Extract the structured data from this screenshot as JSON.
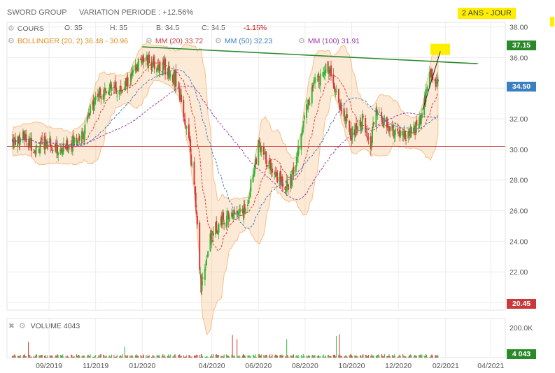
{
  "header": {
    "title": "SWORD GROUP",
    "variation": "VARIATION PERIODE : +12.56%",
    "period_badge": "2 ANS - JOUR"
  },
  "legend": {
    "cours": {
      "label": "COURS",
      "open": "O: 35",
      "high": "H: 35",
      "bid": "B: 34.5",
      "close": "C: 34.5",
      "change": "-1.15%"
    },
    "bollinger": {
      "label": "BOLLINGER (20, 2)",
      "values": "36.48 - 30.96"
    },
    "mm20": {
      "label": "MM (20)",
      "value": "33.72"
    },
    "mm50": {
      "label": "MM (50)",
      "value": "32.23"
    },
    "mm100": {
      "label": "MM (100)",
      "value": "31.91"
    },
    "volume": {
      "label": "VOLUME",
      "value": "4043"
    }
  },
  "tags": {
    "high": "37.15",
    "last": "34.50",
    "low": "20.45",
    "volume": "4 043"
  },
  "colors": {
    "up": "#37b437",
    "down": "#d63a3a",
    "band": "#f5c08a",
    "mm20": "#e03a3a",
    "mm50": "#3a7fc0",
    "mm100": "#9a3fa6",
    "resistance": "#2a8a2a",
    "support": "#c83a3a"
  },
  "chart_data": {
    "type": "candlestick",
    "y_ticks": [
      "38.00",
      "36.00",
      "34.00",
      "32.00",
      "30.00",
      "28.00",
      "26.00",
      "24.00",
      "22.00",
      "20.00"
    ],
    "ylim": [
      19.5,
      38.3
    ],
    "volume_ticks": [
      "200.0K"
    ],
    "x_ticks": [
      "09/2019",
      "11/2019",
      "01/2020",
      "04/2020",
      "06/2020",
      "08/2020",
      "10/2020",
      "12/2020",
      "02/2021",
      "04/2021"
    ],
    "series": [
      {
        "name": "COURS",
        "close_path": [
          [
            "2019-07-15",
            30.6
          ],
          [
            "2019-08-01",
            30.8
          ],
          [
            "2019-08-15",
            30.0
          ],
          [
            "2019-09-01",
            30.6
          ],
          [
            "2019-09-15",
            29.8
          ],
          [
            "2019-10-01",
            30.5
          ],
          [
            "2019-10-15",
            30.9
          ],
          [
            "2019-11-01",
            33.5
          ],
          [
            "2019-11-15",
            34.0
          ],
          [
            "2019-12-01",
            33.8
          ],
          [
            "2019-12-15",
            34.4
          ],
          [
            "2020-01-01",
            36.0
          ],
          [
            "2020-01-15",
            35.5
          ],
          [
            "2020-02-01",
            35.3
          ],
          [
            "2020-02-15",
            34.5
          ],
          [
            "2020-03-01",
            31.0
          ],
          [
            "2020-03-10",
            27.0
          ],
          [
            "2020-03-18",
            21.0
          ],
          [
            "2020-03-25",
            23.0
          ],
          [
            "2020-04-01",
            24.5
          ],
          [
            "2020-04-15",
            25.5
          ],
          [
            "2020-05-01",
            25.8
          ],
          [
            "2020-05-15",
            26.0
          ],
          [
            "2020-06-01",
            30.2
          ],
          [
            "2020-06-15",
            29.0
          ],
          [
            "2020-07-01",
            28.0
          ],
          [
            "2020-07-10",
            27.5
          ],
          [
            "2020-07-20",
            29.0
          ],
          [
            "2020-08-01",
            32.5
          ],
          [
            "2020-08-15",
            34.5
          ],
          [
            "2020-09-01",
            35.5
          ],
          [
            "2020-09-15",
            33.0
          ],
          [
            "2020-10-01",
            31.0
          ],
          [
            "2020-10-15",
            32.0
          ],
          [
            "2020-10-25",
            29.8
          ],
          [
            "2020-11-01",
            32.5
          ],
          [
            "2020-11-15",
            31.5
          ],
          [
            "2020-12-01",
            31.0
          ],
          [
            "2020-12-15",
            30.8
          ],
          [
            "2021-01-01",
            32.0
          ],
          [
            "2021-01-10",
            35.0
          ],
          [
            "2021-01-20",
            34.5
          ]
        ]
      },
      {
        "name": "MM (20)",
        "last": 33.72
      },
      {
        "name": "MM (50)",
        "last": 32.23
      },
      {
        "name": "MM (100)",
        "last": 31.91
      }
    ],
    "annotations": [
      {
        "type": "resistance",
        "from": [
          "2020-01-01",
          36.7
        ],
        "to": [
          "2021-03-15",
          35.6
        ]
      },
      {
        "type": "support",
        "value": 30.2
      }
    ],
    "grid": true
  }
}
